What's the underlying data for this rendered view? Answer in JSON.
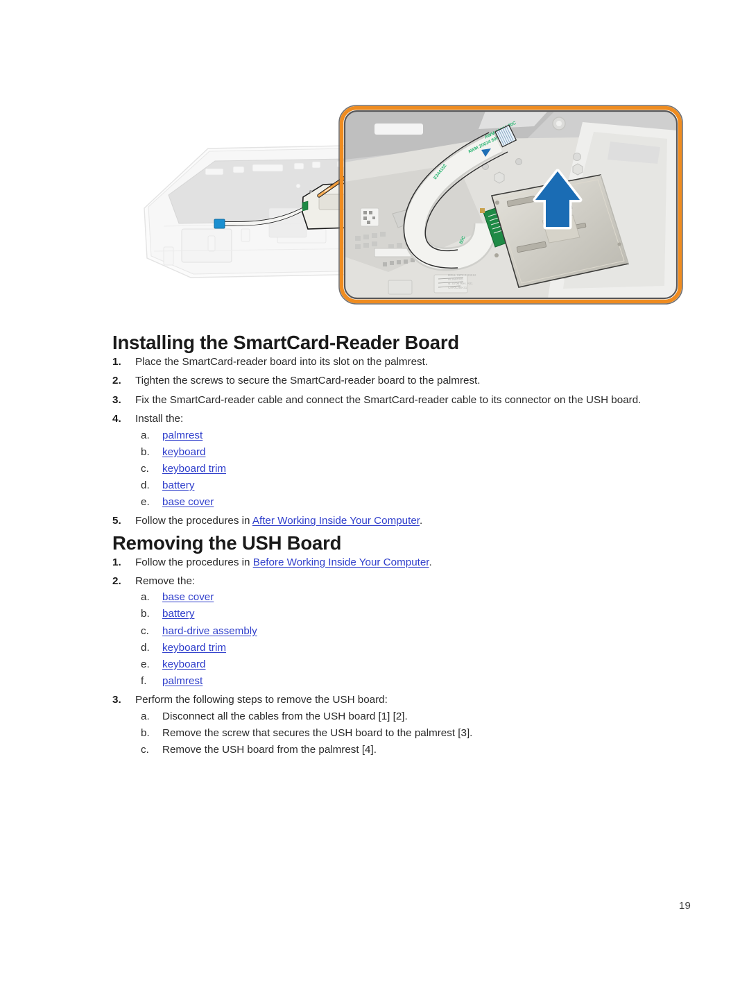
{
  "figure": {
    "alt_description": "Exploded view of laptop palmrest with SmartCard-reader board callout",
    "callout_border_color": "#ef8c20",
    "callout_inner_border_color": "#58585a",
    "arrow_color": "#1a6cb4",
    "leader_line_color": "#f5a33c",
    "ghost_fill": "#f2f2f2",
    "ghost_stroke": "#d8d8d8",
    "board_fill": "#c9c9c4",
    "pcb_color": "#1f8a46",
    "ribbon_text_color": "#2bb673",
    "ribbon_labels": [
      "AWM 20624 80C",
      "AWM 20624 80C",
      "E344152"
    ],
    "connector_tab_color": "#1a8fd0"
  },
  "sections": [
    {
      "heading": "Installing the SmartCard-Reader Board",
      "steps": [
        {
          "marker": "1.",
          "text": "Place the SmartCard-reader board into its slot on the palmrest."
        },
        {
          "marker": "2.",
          "text": "Tighten the screws to secure the SmartCard-reader board to the palmrest."
        },
        {
          "marker": "3.",
          "text": "Fix the SmartCard-reader cable and connect the SmartCard-reader cable to its connector on the USH board."
        },
        {
          "marker": "4.",
          "text": "Install the:",
          "substeps": [
            {
              "marker": "a.",
              "link": "palmrest"
            },
            {
              "marker": "b.",
              "link": "keyboard"
            },
            {
              "marker": "c.",
              "link": "keyboard trim"
            },
            {
              "marker": "d.",
              "link": "battery"
            },
            {
              "marker": "e.",
              "link": "base cover"
            }
          ]
        },
        {
          "marker": "5.",
          "text_before": "Follow the procedures in ",
          "link": "After Working Inside Your Computer",
          "text_after": "."
        }
      ]
    },
    {
      "heading": "Removing the USH Board",
      "steps": [
        {
          "marker": "1.",
          "text_before": "Follow the procedures in ",
          "link": "Before Working Inside Your Computer",
          "text_after": "."
        },
        {
          "marker": "2.",
          "text": "Remove the:",
          "substeps": [
            {
              "marker": "a.",
              "link": "base cover"
            },
            {
              "marker": "b.",
              "link": "battery"
            },
            {
              "marker": "c.",
              "link": "hard-drive assembly"
            },
            {
              "marker": "d.",
              "link": "keyboard trim"
            },
            {
              "marker": "e.",
              "link": "keyboard"
            },
            {
              "marker": "f.",
              "link": "palmrest"
            }
          ]
        },
        {
          "marker": "3.",
          "text": "Perform the following steps to remove the USH board:",
          "substeps": [
            {
              "marker": "a.",
              "text": "Disconnect all the cables from the USH board [1] [2]."
            },
            {
              "marker": "b.",
              "text": "Remove the screw that secures the USH board to the palmrest [3]."
            },
            {
              "marker": "c.",
              "text": "Remove the USH board from the palmrest [4]."
            }
          ]
        }
      ]
    }
  ],
  "footer": {
    "page_number": "19"
  }
}
